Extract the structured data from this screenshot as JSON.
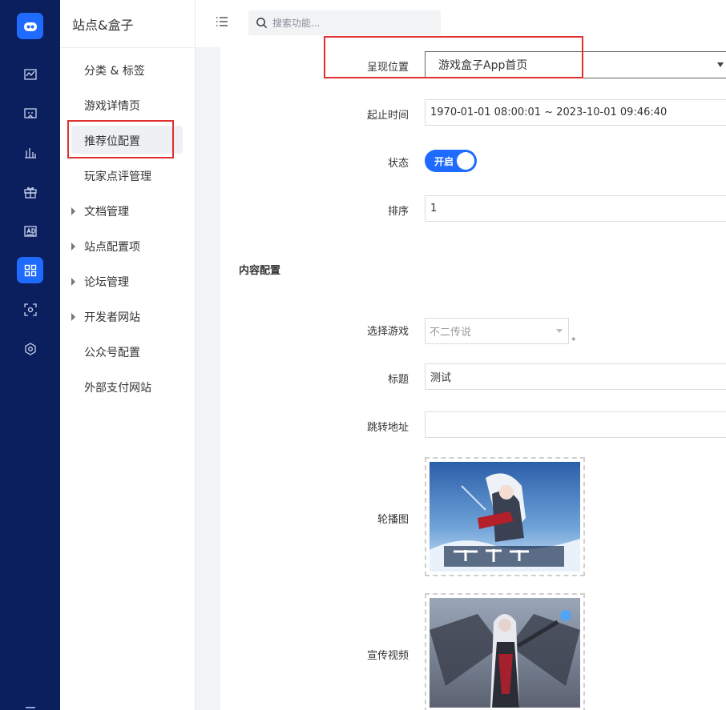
{
  "rail": {
    "items": [
      {
        "name": "logo-icon"
      },
      {
        "name": "chart-line-icon"
      },
      {
        "name": "screen-icon"
      },
      {
        "name": "bar-chart-icon"
      },
      {
        "name": "gift-icon"
      },
      {
        "name": "ad-icon"
      },
      {
        "name": "grid-icon"
      },
      {
        "name": "scan-icon"
      },
      {
        "name": "settings-icon"
      }
    ],
    "accent": "#1f6bff",
    "background": "#0b1f5e"
  },
  "sidebar": {
    "title": "站点&盒子",
    "items": [
      {
        "label": "分类 & 标签",
        "expandable": false
      },
      {
        "label": "游戏详情页",
        "expandable": false
      },
      {
        "label": "推荐位配置",
        "expandable": false,
        "active": true
      },
      {
        "label": "玩家点评管理",
        "expandable": false
      },
      {
        "label": "文档管理",
        "expandable": true
      },
      {
        "label": "站点配置项",
        "expandable": true
      },
      {
        "label": "论坛管理",
        "expandable": true
      },
      {
        "label": "开发者网站",
        "expandable": true
      },
      {
        "label": "公众号配置",
        "expandable": false
      },
      {
        "label": "外部支付网站",
        "expandable": false
      }
    ]
  },
  "topbar": {
    "search_placeholder": "搜索功能..."
  },
  "form": {
    "position_label": "呈现位置",
    "position_value": "游戏盒子App首页",
    "time_label": "起止时间",
    "time_value": "1970-01-01 08:00:01 ~ 2023-10-01 09:46:40",
    "status_label": "状态",
    "status_value": "开启",
    "sort_label": "排序",
    "sort_value": "1",
    "section_title": "内容配置",
    "game_label": "选择游戏",
    "game_value": "不二传说",
    "required_mark": "*",
    "title_label": "标题",
    "title_value": "测试",
    "link_label": "跳转地址",
    "link_value": "",
    "carousel_label": "轮播图",
    "video_label": "宣传视频"
  },
  "colors": {
    "highlight": "#e03030",
    "toggle_on": "#1f6bff"
  }
}
